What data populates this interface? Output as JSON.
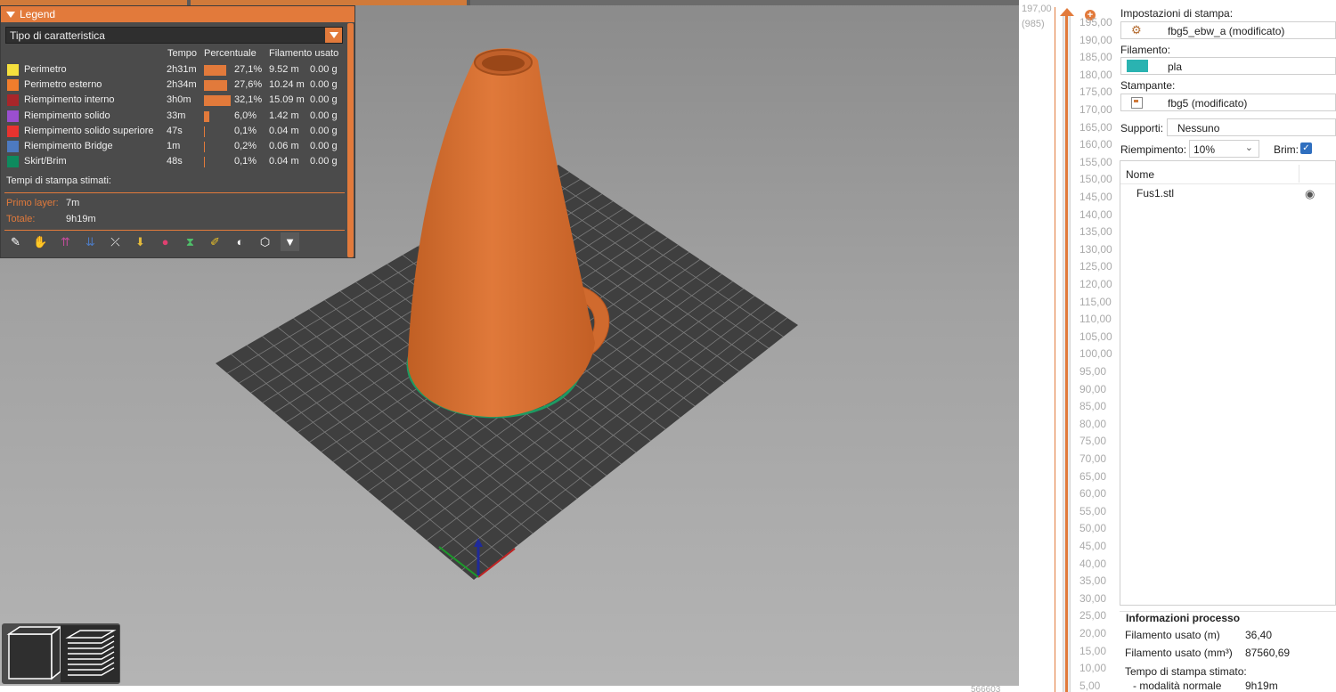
{
  "legend": {
    "title": "Legend",
    "feature_type_select": "Tipo di caratteristica",
    "columns": {
      "time": "Tempo",
      "percent": "Percentuale",
      "filament": "Filamento usato"
    },
    "rows": [
      {
        "name": "Perimetro",
        "color": "#f5e03d",
        "time": "2h31m",
        "pct_value": 27.1,
        "percent": "27,1%",
        "meters": "9.52 m",
        "grams": "0.00 g"
      },
      {
        "name": "Perimetro esterno",
        "color": "#f07d2c",
        "time": "2h34m",
        "pct_value": 27.6,
        "percent": "27,6%",
        "meters": "10.24 m",
        "grams": "0.00 g"
      },
      {
        "name": "Riempimento interno",
        "color": "#a8262a",
        "time": "3h0m",
        "pct_value": 32.1,
        "percent": "32,1%",
        "meters": "15.09 m",
        "grams": "0.00 g"
      },
      {
        "name": "Riempimento solido",
        "color": "#9b4fcf",
        "time": "33m",
        "pct_value": 6.0,
        "percent": "6,0%",
        "meters": "1.42 m",
        "grams": "0.00 g"
      },
      {
        "name": "Riempimento solido superiore",
        "color": "#e8332f",
        "time": "47s",
        "pct_value": 0.1,
        "percent": "0,1%",
        "meters": "0.04 m",
        "grams": "0.00 g"
      },
      {
        "name": "Riempimento Bridge",
        "color": "#4d7ac0",
        "time": "1m",
        "pct_value": 0.2,
        "percent": "0,2%",
        "meters": "0.06 m",
        "grams": "0.00 g"
      },
      {
        "name": "Skirt/Brim",
        "color": "#0e8a5e",
        "time": "48s",
        "pct_value": 0.1,
        "percent": "0,1%",
        "meters": "0.04 m",
        "grams": "0.00 g"
      }
    ],
    "estimated_times_title": "Tempi di stampa stimati:",
    "first_layer_label": "Primo layer:",
    "first_layer_value": "7m",
    "total_label": "Totale:",
    "total_value": "9h19m",
    "tool_icons": [
      "travel-icon",
      "wipe-icon",
      "retractions-icon",
      "deretractions-icon",
      "seams-icon",
      "tool-changes-icon",
      "color-changes-icon",
      "pause-icon",
      "custom-gcode-icon",
      "center-of-gravity-icon",
      "shells-icon",
      "tool-marker-icon"
    ]
  },
  "slider": {
    "top_value": "197,00",
    "top_layer": "(985)",
    "ticks": [
      "195,00",
      "190,00",
      "185,00",
      "180,00",
      "175,00",
      "170,00",
      "165,00",
      "160,00",
      "155,00",
      "150,00",
      "145,00",
      "140,00",
      "135,00",
      "130,00",
      "125,00",
      "120,00",
      "115,00",
      "110,00",
      "105,00",
      "100,00",
      "95,00",
      "90,00",
      "85,00",
      "80,00",
      "75,00",
      "70,00",
      "65,00",
      "60,00",
      "55,00",
      "50,00",
      "45,00",
      "40,00",
      "35,00",
      "30,00",
      "25,00",
      "20,00",
      "15,00",
      "10,00",
      "5,00"
    ]
  },
  "sidebar": {
    "print_settings_label": "Impostazioni di stampa:",
    "print_settings_value": "fbg5_ebw_a (modificato)",
    "filament_label": "Filamento:",
    "filament_value": "pla",
    "filament_color": "#2ab3b1",
    "printer_label": "Stampante:",
    "printer_value": "fbg5 (modificato)",
    "supports_label": "Supporti:",
    "supports_value": "Nessuno",
    "infill_label": "Riempimento:",
    "infill_value": "10%",
    "brim_label": "Brim:",
    "brim_checked": true,
    "objects_header": "Nome",
    "object_name": "Fus1.stl",
    "info_title": "Informazioni processo",
    "info_rows": [
      {
        "key": "Filamento usato (m)",
        "value": "36,40"
      },
      {
        "key": "Filamento usato (mm³)",
        "value": "87560,69"
      },
      {
        "key": "Tempo di stampa stimato:",
        "value": ""
      },
      {
        "key": "- modalità normale",
        "value": "9h19m"
      }
    ]
  },
  "footer_number": "566603",
  "accent": "#e27a3b"
}
